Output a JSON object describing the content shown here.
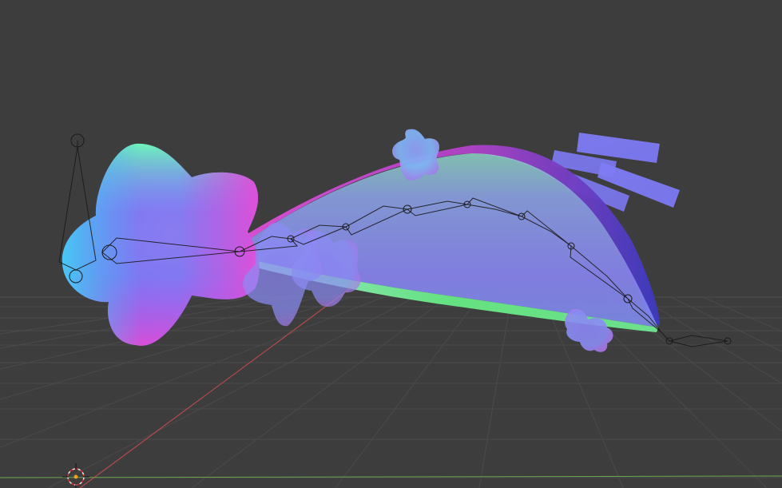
{
  "viewport": {
    "background": "#3d3d3d",
    "grid_color": "#4a4a4a",
    "x_axis_color": "#b44a4a",
    "y_axis_color": "#6aa84f",
    "shading": "normal-map"
  },
  "scene": {
    "objects": [
      {
        "name": "star-main",
        "kind": "mesh"
      },
      {
        "name": "shooting-trail",
        "kind": "mesh"
      },
      {
        "name": "small-star-top",
        "kind": "mesh"
      },
      {
        "name": "small-stars-mid",
        "kind": "mesh"
      },
      {
        "name": "small-star-bottom",
        "kind": "mesh"
      },
      {
        "name": "speed-lines",
        "kind": "mesh"
      },
      {
        "name": "armature-trail",
        "kind": "armature"
      },
      {
        "name": "armature-star",
        "kind": "armature"
      },
      {
        "name": "armature-tip",
        "kind": "armature"
      },
      {
        "name": "3d-cursor",
        "kind": "cursor"
      }
    ]
  }
}
